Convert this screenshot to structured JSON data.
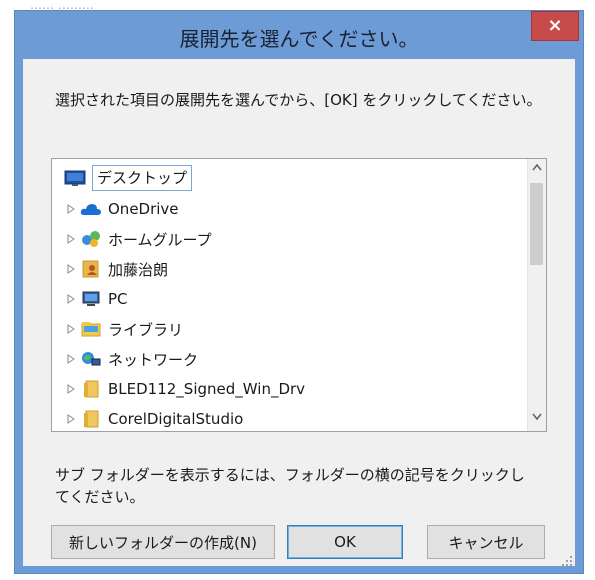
{
  "background": {
    "faint_text": "…… ………"
  },
  "dialog": {
    "title": "展開先を選んでください。",
    "close_label": "×",
    "instruction": "選択された項目の展開先を選んでから、[OK] をクリックしてください。",
    "tree": {
      "items": [
        {
          "label": "デスクトップ",
          "icon": "desktop-icon",
          "selected": true,
          "expander": false
        },
        {
          "label": "OneDrive",
          "icon": "cloud-icon",
          "expander": true
        },
        {
          "label": "ホームグループ",
          "icon": "homegroup-icon",
          "expander": true
        },
        {
          "label": "加藤治朗",
          "icon": "user-folder-icon",
          "expander": true
        },
        {
          "label": "PC",
          "icon": "computer-icon",
          "expander": true
        },
        {
          "label": "ライブラリ",
          "icon": "library-icon",
          "expander": true
        },
        {
          "label": "ネットワーク",
          "icon": "network-icon",
          "expander": true
        },
        {
          "label": "BLED112_Signed_Win_Drv",
          "icon": "folder-icon",
          "expander": true
        },
        {
          "label": "CorelDigitalStudio",
          "icon": "folder-icon",
          "expander": true
        }
      ]
    },
    "hint": "サブ フォルダーを表示するには、フォルダーの横の記号をクリックしてください。",
    "buttons": {
      "new_folder": "新しいフォルダーの作成(N)",
      "ok": "OK",
      "cancel": "キャンセル"
    }
  },
  "colors": {
    "frame": "#6c9bd6",
    "close": "#c74b4b",
    "client": "#f0f0f0",
    "selection_border": "#7aa7d8"
  }
}
